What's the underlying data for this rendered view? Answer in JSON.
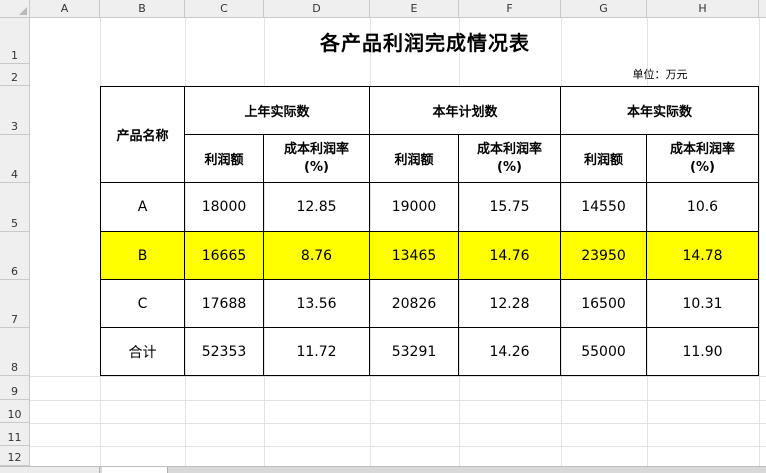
{
  "columns": [
    "A",
    "B",
    "C",
    "D",
    "E",
    "F",
    "G",
    "H"
  ],
  "rows": [
    "1",
    "2",
    "3",
    "4",
    "5",
    "6",
    "7",
    "8",
    "9",
    "10",
    "11",
    "12"
  ],
  "sheet": {
    "title": "各产品利润完成情况表",
    "unit": "单位：万元",
    "header": {
      "product_name": "产品名称",
      "groups": [
        "上年实际数",
        "本年计划数",
        "本年实际数"
      ],
      "profit": "利润额",
      "rate": "成本利润率\n(%)"
    },
    "body": [
      [
        "A",
        "18000",
        "12.85",
        "19000",
        "15.75",
        "14550",
        "10.6"
      ],
      [
        "B",
        "16665",
        "8.76",
        "13465",
        "14.76",
        "23950",
        "14.78"
      ],
      [
        "C",
        "17688",
        "13.56",
        "20826",
        "12.28",
        "16500",
        "10.31"
      ],
      [
        "合计",
        "52353",
        "11.72",
        "53291",
        "14.26",
        "55000",
        "11.90"
      ]
    ],
    "highlight_color": "#ffff00"
  }
}
